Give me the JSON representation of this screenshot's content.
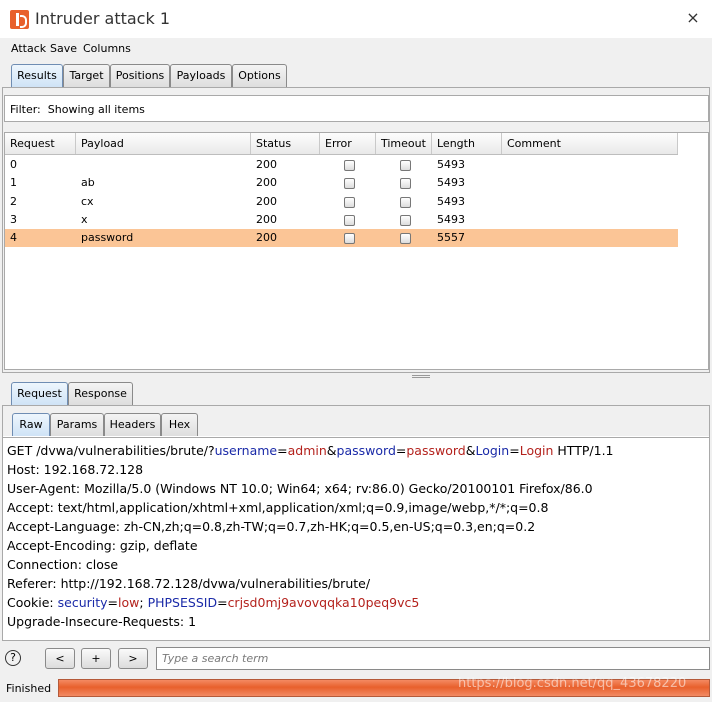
{
  "window": {
    "title": "Intruder attack 1",
    "close": "×"
  },
  "menu": [
    "Attack",
    "Save",
    "Columns"
  ],
  "main_tabs": [
    {
      "label": "Results",
      "active": true
    },
    {
      "label": "Target",
      "active": false
    },
    {
      "label": "Positions",
      "active": false
    },
    {
      "label": "Payloads",
      "active": false
    },
    {
      "label": "Options",
      "active": false
    }
  ],
  "filter": {
    "label": "Filter:",
    "value": "Showing all items"
  },
  "results_table": {
    "columns": [
      "Request",
      "Payload",
      "Status",
      "Error",
      "Timeout",
      "Length",
      "Comment"
    ],
    "rows": [
      {
        "request": "0",
        "payload": "",
        "status": "200",
        "error": false,
        "timeout": false,
        "length": "5493",
        "comment": "",
        "selected": false
      },
      {
        "request": "1",
        "payload": "ab",
        "status": "200",
        "error": false,
        "timeout": false,
        "length": "5493",
        "comment": "",
        "selected": false
      },
      {
        "request": "2",
        "payload": "cx",
        "status": "200",
        "error": false,
        "timeout": false,
        "length": "5493",
        "comment": "",
        "selected": false
      },
      {
        "request": "3",
        "payload": "x",
        "status": "200",
        "error": false,
        "timeout": false,
        "length": "5493",
        "comment": "",
        "selected": false
      },
      {
        "request": "4",
        "payload": "password",
        "status": "200",
        "error": false,
        "timeout": false,
        "length": "5557",
        "comment": "",
        "selected": true
      }
    ]
  },
  "detail_tabs": [
    {
      "label": "Request",
      "active": true
    },
    {
      "label": "Response",
      "active": false
    }
  ],
  "view_tabs": [
    {
      "label": "Raw",
      "active": true
    },
    {
      "label": "Params",
      "active": false
    },
    {
      "label": "Headers",
      "active": false
    },
    {
      "label": "Hex",
      "active": false
    }
  ],
  "raw_request": {
    "line1": {
      "method_path": "GET /dvwa/vulnerabilities/brute/?",
      "p1_key": "username",
      "eq1": "=",
      "p1_val": "admin",
      "amp1": "&",
      "p2_key": "password",
      "eq2": "=",
      "p2_val": "password",
      "amp2": "&",
      "p3_key": "Login",
      "eq3": "=",
      "p3_val": "Login",
      "proto": " HTTP/1.1"
    },
    "host": "Host: 192.168.72.128",
    "user_agent": "User-Agent: Mozilla/5.0 (Windows NT 10.0; Win64; x64; rv:86.0) Gecko/20100101 Firefox/86.0",
    "accept": "Accept: text/html,application/xhtml+xml,application/xml;q=0.9,image/webp,*/*;q=0.8",
    "accept_language": "Accept-Language: zh-CN,zh;q=0.8,zh-TW;q=0.7,zh-HK;q=0.5,en-US;q=0.3,en;q=0.2",
    "accept_encoding": "Accept-Encoding: gzip, deflate",
    "connection": "Connection: close",
    "referer": "Referer: http://192.168.72.128/dvwa/vulnerabilities/brute/",
    "cookie": {
      "prefix": "Cookie: ",
      "c1_key": "security",
      "eq1": "=",
      "c1_val": "low",
      "sep": "; ",
      "c2_key": "PHPSESSID",
      "eq2": "=",
      "c2_val": "crjsd0mj9avovqqka10peq9vc5"
    },
    "upgrade": "Upgrade-Insecure-Requests: 1"
  },
  "search_bar": {
    "help": "?",
    "prev": "<",
    "add": "+",
    "next": ">",
    "placeholder": "Type a search term"
  },
  "status": {
    "text": "Finished",
    "progress": 1.0,
    "progress_color": "#e8602c"
  },
  "watermark": "https://blog.csdn.net/qq_43678220",
  "colors": {
    "selected_row": "#fbc596",
    "param_key": "#1a2aa8",
    "param_value": "#b4221d"
  }
}
